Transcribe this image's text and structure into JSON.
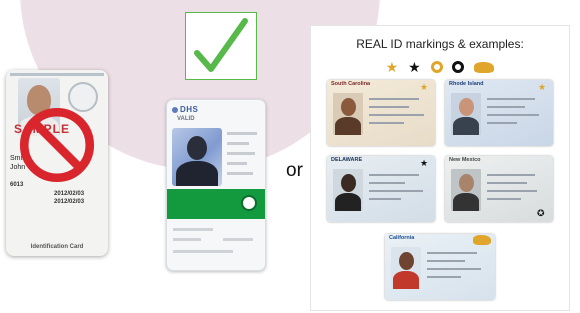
{
  "sample_card": {
    "stamp": "SAMPLE",
    "name_lines": [
      "Smith",
      "John"
    ],
    "number_label": "6013",
    "fields": [
      "2012/02/03",
      "2012/02/03"
    ],
    "footer": "Identification Card"
  },
  "valid_card": {
    "logo": "DHS",
    "subtitle": "VALID"
  },
  "or_label": "or",
  "realid": {
    "title": "REAL ID markings & examples:",
    "markings": [
      "gold-star-icon",
      "black-star-icon",
      "gold-circle-star-icon",
      "black-circle-star-icon",
      "gold-bear-icon"
    ],
    "cards": [
      {
        "header": "South Carolina"
      },
      {
        "header": "Rhode Island"
      },
      {
        "header": "DELAWARE"
      },
      {
        "header": "New Mexico"
      },
      {
        "header": "California"
      }
    ]
  },
  "colors": {
    "no_sign": "#d9262c",
    "check": "#58b94b",
    "accent_green": "#139a3f",
    "background_blob": "#ecdfe6",
    "marking_gold": "#e0a52b"
  }
}
